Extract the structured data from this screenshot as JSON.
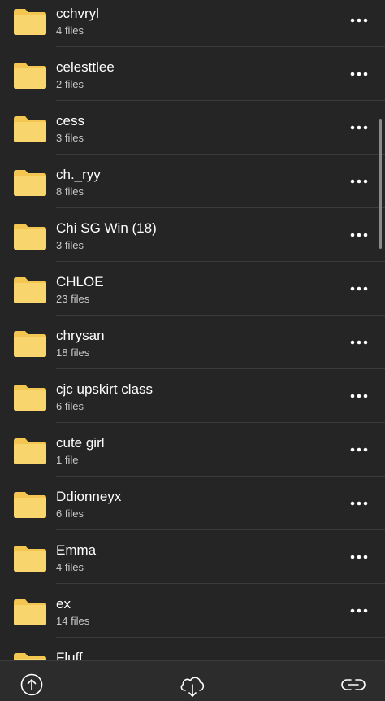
{
  "folders": [
    {
      "name": "cchvryl",
      "count": "4 files"
    },
    {
      "name": "celesttlee",
      "count": "2 files"
    },
    {
      "name": "cess",
      "count": "3 files"
    },
    {
      "name": "ch._ryy",
      "count": "8 files"
    },
    {
      "name": "Chi SG Win (18)",
      "count": "3 files"
    },
    {
      "name": "CHLOE",
      "count": "23 files"
    },
    {
      "name": "chrysan",
      "count": "18 files"
    },
    {
      "name": "cjc upskirt class",
      "count": "6 files"
    },
    {
      "name": "cute girl",
      "count": "1 file"
    },
    {
      "name": "Ddionneyx",
      "count": "6 files"
    },
    {
      "name": "Emma",
      "count": "4 files"
    },
    {
      "name": "ex",
      "count": "14 files"
    },
    {
      "name": "Fluff",
      "count": ""
    }
  ],
  "icons": {
    "folder": "folder-icon",
    "more": "more-icon",
    "upload": "upload-icon",
    "download": "cloud-download-icon",
    "link": "link-icon"
  },
  "colors": {
    "background": "#252525",
    "folder_body": "#F9D56E",
    "folder_tab": "#F3C551",
    "secondary_text": "#c7c7c7"
  }
}
